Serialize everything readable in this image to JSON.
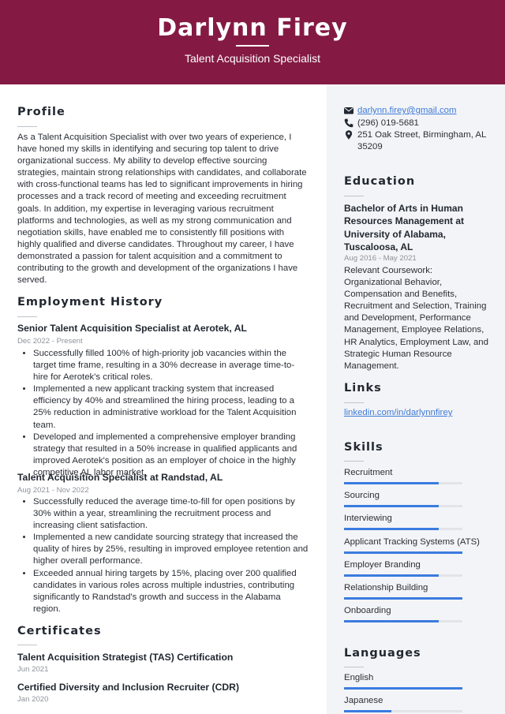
{
  "header": {
    "name": "Darlynn Firey",
    "title": "Talent Acquisition Specialist",
    "background_color": "#841a43"
  },
  "profile": {
    "heading": "Profile",
    "text": "As a Talent Acquisition Specialist with over two years of experience, I have honed my skills in identifying and securing top talent to drive organizational success. My ability to develop effective sourcing strategies, maintain strong relationships with candidates, and collaborate with cross-functional teams has led to significant improvements in hiring processes and a track record of meeting and exceeding recruitment goals. In addition, my expertise in leveraging various recruitment platforms and technologies, as well as my strong communication and negotiation skills, have enabled me to consistently fill positions with highly qualified and diverse candidates. Throughout my career, I have demonstrated a passion for talent acquisition and a commitment to contributing to the growth and development of the organizations I have served."
  },
  "employment": {
    "heading": "Employment History",
    "jobs": [
      {
        "title": "Senior Talent Acquisition Specialist at Aerotek, AL",
        "dates": "Dec 2022 - Present",
        "bullets": [
          "Successfully filled 100% of high-priority job vacancies within the target time frame, resulting in a 30% decrease in average time-to-hire for Aerotek's critical roles.",
          "Implemented a new applicant tracking system that increased efficiency by 40% and streamlined the hiring process, leading to a 25% reduction in administrative workload for the Talent Acquisition team.",
          "Developed and implemented a comprehensive employer branding strategy that resulted in a 50% increase in qualified applicants and improved Aerotek's position as an employer of choice in the highly competitive AL labor market."
        ]
      },
      {
        "title": "Talent Acquisition Specialist at Randstad, AL",
        "dates": "Aug 2021 - Nov 2022",
        "bullets": [
          "Successfully reduced the average time-to-fill for open positions by 30% within a year, streamlining the recruitment process and increasing client satisfaction.",
          "Implemented a new candidate sourcing strategy that increased the quality of hires by 25%, resulting in improved employee retention and higher overall performance.",
          "Exceeded annual hiring targets by 15%, placing over 200 qualified candidates in various roles across multiple industries, contributing significantly to Randstad's growth and success in the Alabama region."
        ]
      }
    ]
  },
  "certificates": {
    "heading": "Certificates",
    "items": [
      {
        "name": "Talent Acquisition Strategist (TAS) Certification",
        "date": "Jun 2021"
      },
      {
        "name": "Certified Diversity and Inclusion Recruiter (CDR)",
        "date": "Jan 2020"
      }
    ]
  },
  "contact": {
    "email": "darlynn.firey@gmail.com",
    "phone": "(296) 019-5681",
    "address": "251 Oak Street, Birmingham, AL 35209",
    "icons": [
      "envelope-icon",
      "phone-icon",
      "map-pin-icon"
    ]
  },
  "education": {
    "heading": "Education",
    "degree": "Bachelor of Arts in Human Resources Management at University of Alabama, Tuscaloosa, AL",
    "dates": "Aug 2016 - May 2021",
    "description": "Relevant Coursework: Organizational Behavior, Compensation and Benefits, Recruitment and Selection, Training and Development, Performance Management, Employee Relations, HR Analytics, Employment Law, and Strategic Human Resource Management."
  },
  "links": {
    "heading": "Links",
    "items": [
      {
        "label": "linkedin.com/in/darlynnfirey"
      }
    ]
  },
  "skills": {
    "heading": "Skills",
    "bar_color": "#3b7be0",
    "items": [
      {
        "name": "Recruitment",
        "level": 0.8
      },
      {
        "name": "Sourcing",
        "level": 0.8
      },
      {
        "name": "Interviewing",
        "level": 0.8
      },
      {
        "name": "Applicant Tracking Systems (ATS)",
        "level": 1.0
      },
      {
        "name": "Employer Branding",
        "level": 0.8
      },
      {
        "name": "Relationship Building",
        "level": 1.0
      },
      {
        "name": "Onboarding",
        "level": 0.8
      }
    ]
  },
  "languages": {
    "heading": "Languages",
    "items": [
      {
        "name": "English",
        "level": 1.0
      },
      {
        "name": "Japanese",
        "level": 0.4
      }
    ]
  }
}
